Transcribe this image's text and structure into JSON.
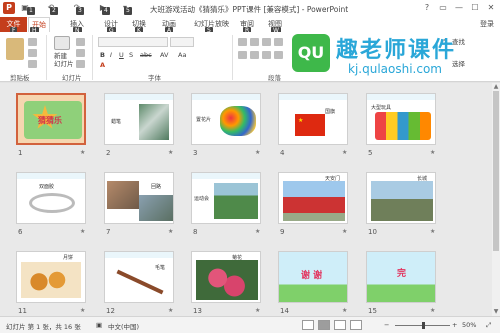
{
  "window": {
    "title": "大班游戏活动《猜猜乐》PPT课件 [兼容模式] - PowerPoint",
    "controls": [
      "?",
      "▭",
      "—",
      "☐",
      "✕"
    ]
  },
  "tabs": {
    "file": "文件",
    "items": [
      {
        "label": "开始",
        "keytip": "H",
        "active": true
      },
      {
        "label": "插入",
        "keytip": "N"
      },
      {
        "label": "设计",
        "keytip": "G"
      },
      {
        "label": "切换",
        "keytip": "K"
      },
      {
        "label": "动画",
        "keytip": "A"
      },
      {
        "label": "幻灯片放映",
        "keytip": "S"
      },
      {
        "label": "审阅",
        "keytip": "R"
      },
      {
        "label": "视图",
        "keytip": "W"
      }
    ],
    "file_keytip": "F",
    "login": "登录"
  },
  "quick_access_keytips": [
    "1",
    "2",
    "3",
    "4",
    "5"
  ],
  "ribbon": {
    "groups": [
      "剪贴板",
      "幻灯片",
      "字体",
      "段落"
    ],
    "new_slide": "新建\n幻灯片",
    "find": "查找",
    "select": "选择"
  },
  "watermark": {
    "logo": "QU",
    "brand": "趣老师课件",
    "url": "kj.qulaoshi.com"
  },
  "slides": [
    {
      "num": "1",
      "title": "猜猜乐",
      "selected": true
    },
    {
      "num": "2",
      "title": "蜡笔"
    },
    {
      "num": "3",
      "title": "置花片"
    },
    {
      "num": "4",
      "title": "国旗"
    },
    {
      "num": "5",
      "title": "大型玩具"
    },
    {
      "num": "6",
      "title": "双面胶"
    },
    {
      "num": "7",
      "title": "回路"
    },
    {
      "num": "8",
      "title": "运动会"
    },
    {
      "num": "9",
      "title": "天安门"
    },
    {
      "num": "10",
      "title": "长城"
    },
    {
      "num": "11",
      "title": "月饼"
    },
    {
      "num": "12",
      "title": "毛笔"
    },
    {
      "num": "13",
      "title": "菊花"
    },
    {
      "num": "14",
      "title": "谢  谢"
    },
    {
      "num": "15",
      "title": "完"
    }
  ],
  "status": {
    "slide_info": "幻灯片 第 1 张，共 16 张",
    "language": "中文(中国)",
    "zoom": "50%",
    "zoom_level": 0.5
  },
  "colors": {
    "accent": "#c43e1c",
    "watermark": "#2aa7d8"
  }
}
